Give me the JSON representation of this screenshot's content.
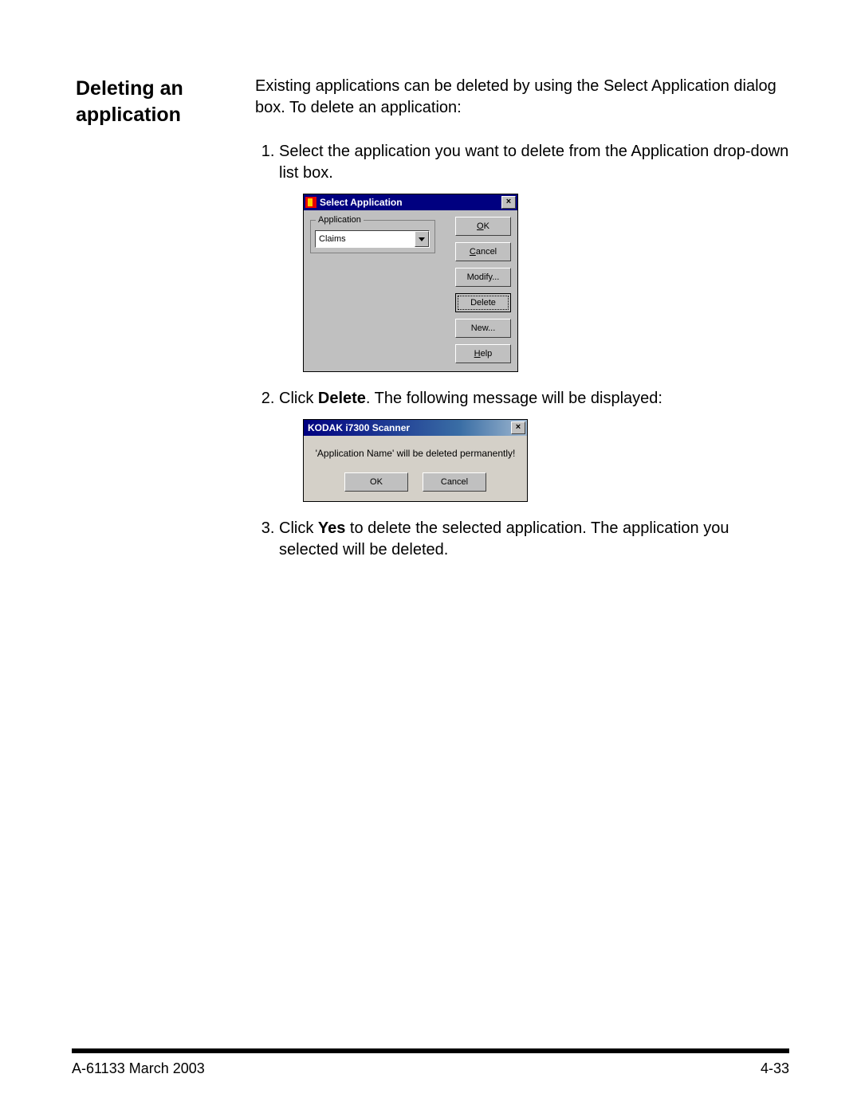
{
  "heading": "Deleting an application",
  "intro": "Existing applications can be deleted by using the Select Application dialog box. To delete an application:",
  "step1": "Select the application you want to delete from the Application drop-down list box.",
  "step2_pre": "Click ",
  "step2_bold": "Delete",
  "step2_post": ". The following message will be displayed:",
  "step3_pre": "Click ",
  "step3_bold": "Yes",
  "step3_post": " to delete the selected application. The application you selected will be deleted.",
  "dlg1": {
    "title": "Select Application",
    "fieldset_label": "Application",
    "combo_value": "Claims",
    "buttons": {
      "ok": "OK",
      "cancel": "Cancel",
      "modify": "Modify...",
      "delete": "Delete",
      "new": "New...",
      "help": "Help"
    }
  },
  "dlg2": {
    "title": "KODAK i7300 Scanner",
    "message": "'Application Name' will be deleted permanently!",
    "ok": "OK",
    "cancel": "Cancel"
  },
  "footer": {
    "left": "A-61133  March 2003",
    "right": "4-33"
  }
}
